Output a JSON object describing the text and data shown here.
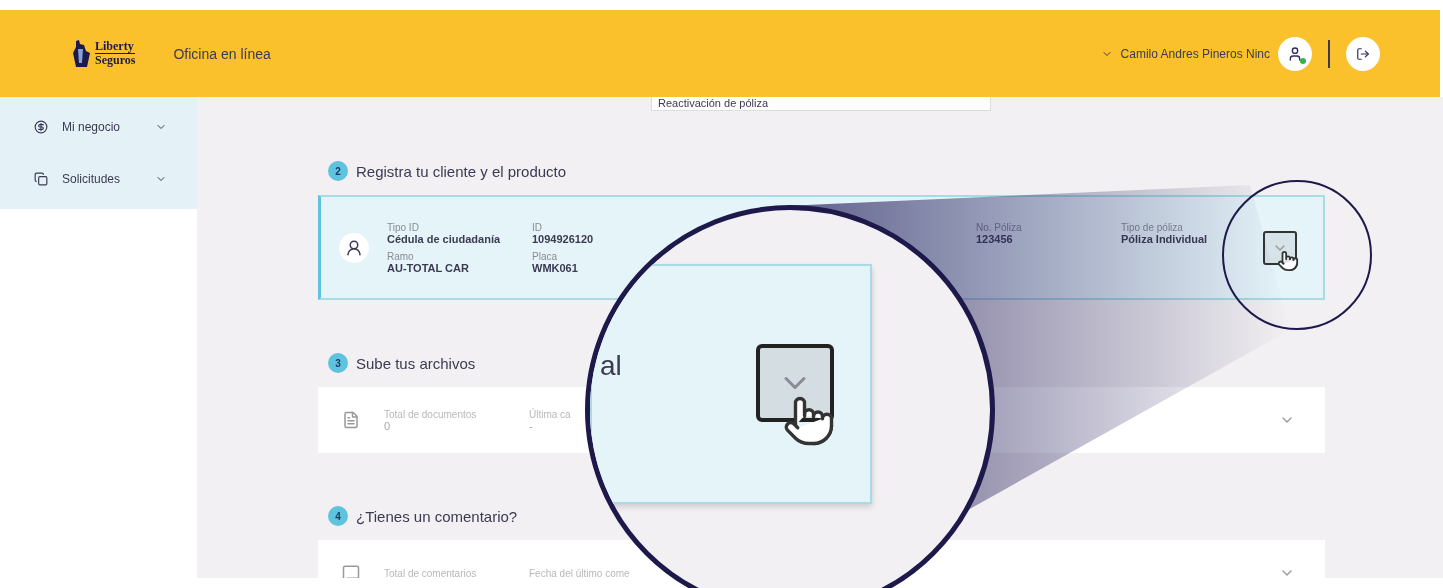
{
  "header": {
    "brand_top": "Liberty",
    "brand_bottom": "Seguros",
    "title": "Oficina en línea",
    "user": "Camilo Andres Pineros Ninc",
    "online": true
  },
  "sidebar": {
    "items": [
      {
        "label": "Mi negocio",
        "kind": "money"
      },
      {
        "label": "Solicitudes",
        "kind": "requests"
      }
    ]
  },
  "top_field": {
    "value": "Reactivación de póliza"
  },
  "sections": [
    {
      "number": "2",
      "title": "Registra tu cliente y el producto",
      "card": {
        "kind": "product",
        "highlighted": true,
        "columns": [
          [
            {
              "label": "Tipo ID",
              "value": "Cédula de ciudadanía"
            },
            {
              "label": "Ramo",
              "value": "AU-TOTAL CAR"
            }
          ],
          [
            {
              "label": "ID",
              "value": "1094926120"
            },
            {
              "label": "Placa",
              "value": "WMK061"
            }
          ],
          [
            {
              "label": "No. Póliza",
              "value": "123456"
            }
          ],
          [
            {
              "label": "Tipo de póliza",
              "value": "Póliza Individual"
            }
          ]
        ]
      }
    },
    {
      "number": "3",
      "title": "Sube tus archivos",
      "card": {
        "kind": "documents",
        "highlighted": false,
        "columns": [
          [
            {
              "label": "Total de documentos",
              "value": "0"
            }
          ],
          [
            {
              "label": "Última ca",
              "value": "-"
            }
          ]
        ]
      }
    },
    {
      "number": "4",
      "title": "¿Tienes un comentario?",
      "card": {
        "kind": "comments",
        "highlighted": false,
        "columns": [
          [
            {
              "label": "Total de comentarios"
            }
          ],
          [
            {
              "label": "Fecha del último come"
            }
          ]
        ]
      }
    }
  ],
  "magnifier": {
    "text": "al"
  }
}
